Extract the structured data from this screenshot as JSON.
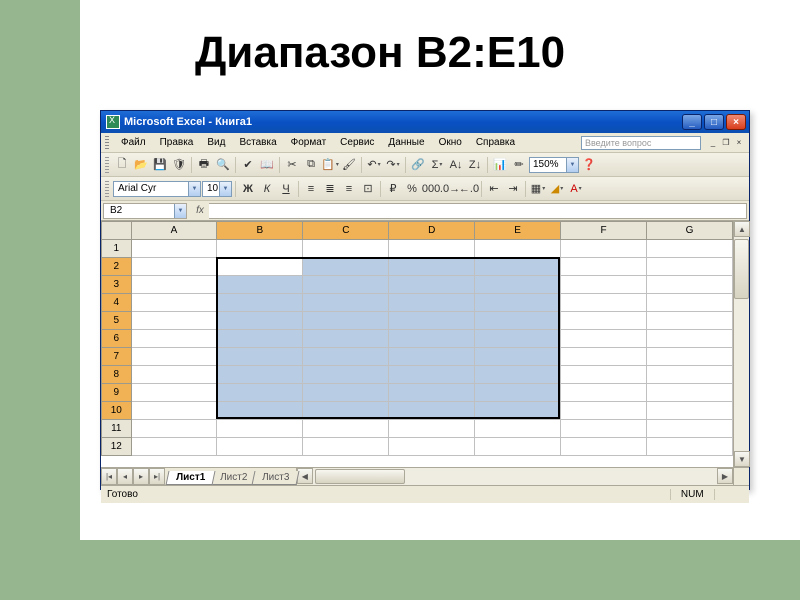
{
  "slide": {
    "title": "Диапазон B2:E10"
  },
  "window": {
    "title": "Microsoft Excel - Книга1"
  },
  "menu": {
    "items": [
      "Файл",
      "Правка",
      "Вид",
      "Вставка",
      "Формат",
      "Сервис",
      "Данные",
      "Окно",
      "Справка"
    ],
    "help_placeholder": "Введите вопрос"
  },
  "toolbar1": {
    "zoom": "150%"
  },
  "toolbar2": {
    "font": "Arial Cyr",
    "size": "10"
  },
  "namebox": {
    "value": "B2"
  },
  "columns": [
    "A",
    "B",
    "C",
    "D",
    "E",
    "F",
    "G"
  ],
  "rows": [
    "1",
    "2",
    "3",
    "4",
    "5",
    "6",
    "7",
    "8",
    "9",
    "10",
    "11",
    "12"
  ],
  "selection": {
    "active_cell": "B2",
    "sel_cols": [
      "B",
      "C",
      "D",
      "E"
    ],
    "sel_rows": [
      "2",
      "3",
      "4",
      "5",
      "6",
      "7",
      "8",
      "9",
      "10"
    ]
  },
  "sheets": {
    "tabs": [
      "Лист1",
      "Лист2",
      "Лист3"
    ],
    "active": "Лист1"
  },
  "status": {
    "ready": "Готово",
    "num": "NUM"
  }
}
